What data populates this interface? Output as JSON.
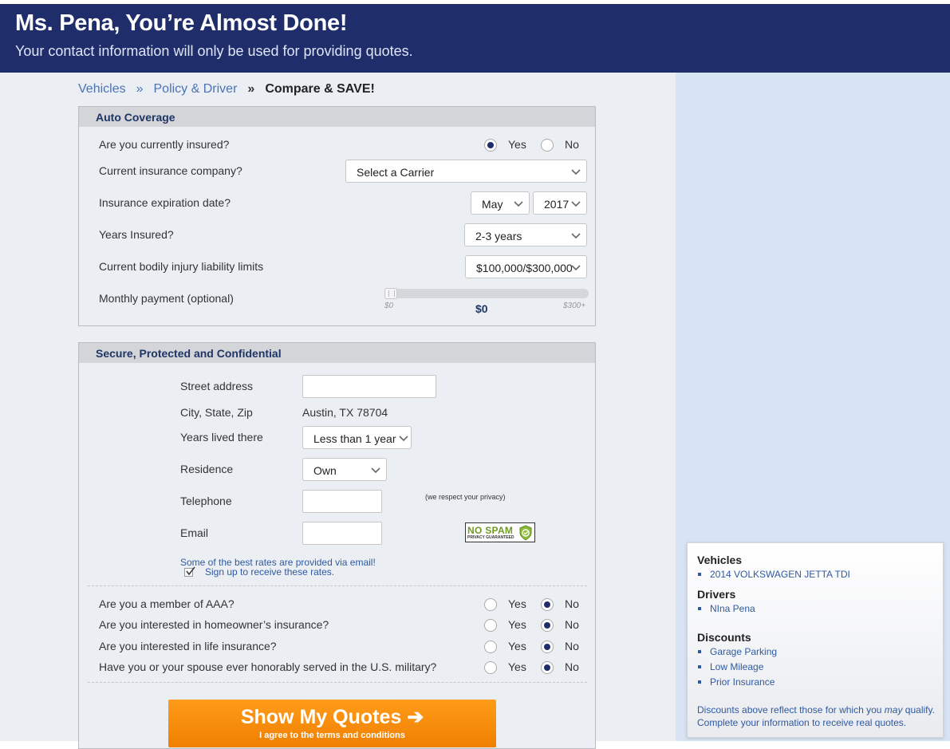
{
  "header": {
    "title": "Ms. Pena, You’re Almost Done!",
    "subtitle": "Your contact information will only be used for providing quotes."
  },
  "breadcrumb": {
    "step1": "Vehicles",
    "sep1": "»",
    "step2": "Policy & Driver",
    "sep2": "»",
    "step3": "Compare & SAVE!"
  },
  "auto_coverage": {
    "heading": "Auto Coverage",
    "currently_insured": {
      "label": "Are you currently insured?",
      "yes": "Yes",
      "no": "No",
      "selected": "Yes"
    },
    "company": {
      "label": "Current insurance company?",
      "value": "Select a Carrier"
    },
    "expiration": {
      "label": "Insurance expiration date?",
      "month": "May",
      "year": "2017"
    },
    "years_insured": {
      "label": "Years Insured?",
      "value": "2-3 years"
    },
    "bodily_limits": {
      "label": "Current bodily injury liability limits",
      "value": "$100,000/$300,000"
    },
    "monthly_payment": {
      "label": "Monthly payment (optional)",
      "min": "$0",
      "max": "$300+",
      "current": "$0",
      "level": 0
    }
  },
  "secure": {
    "heading": "Secure, Protected and Confidential",
    "street": {
      "label": "Street address",
      "value": ""
    },
    "city": {
      "label": "City, State, Zip",
      "value": "Austin, TX 78704"
    },
    "years_lived": {
      "label": "Years lived there",
      "value": "Less than 1 year"
    },
    "residence": {
      "label": "Residence",
      "value": "Own"
    },
    "telephone": {
      "label": "Telephone",
      "value": "",
      "privacy_note": "(we respect your privacy)"
    },
    "email": {
      "label": "Email",
      "value": ""
    },
    "nospam": {
      "title": "NO SPAM",
      "subtitle": "PRIVACY GUARANTEED"
    },
    "email_note": "Some of the best rates are provided via email!",
    "signup_label": "Sign up to receive these rates.",
    "signup_checked": true
  },
  "questions": [
    {
      "label": "Are you a member of AAA?",
      "yes": "Yes",
      "no": "No",
      "selected": "No"
    },
    {
      "label": "Are you interested in homeowner’s insurance?",
      "yes": "Yes",
      "no": "No",
      "selected": "No"
    },
    {
      "label": "Are you interested in life insurance?",
      "yes": "Yes",
      "no": "No",
      "selected": "No"
    },
    {
      "label": "Have you or your spouse ever honorably served in the U.S. military?",
      "yes": "Yes",
      "no": "No",
      "selected": "No"
    }
  ],
  "submit": {
    "label": "Show My Quotes ➔",
    "note": "I agree to the terms and conditions"
  },
  "summary": {
    "vehicles_heading": "Vehicles",
    "vehicles": [
      "2014 VOLKSWAGEN JETTA TDI"
    ],
    "drivers_heading": "Drivers",
    "drivers": [
      "NIna Pena"
    ],
    "discounts_heading": "Discounts",
    "discounts": [
      "Garage Parking",
      "Low Mileage",
      "Prior Insurance"
    ],
    "footer_pre": "Discounts above reflect those for which you ",
    "footer_em": "may",
    "footer_post": " qualify. Complete your information to receive real quotes."
  },
  "colors": {
    "header_bg": "#1f2d6b",
    "button": "#f68b00",
    "link": "#2f5aa0"
  }
}
